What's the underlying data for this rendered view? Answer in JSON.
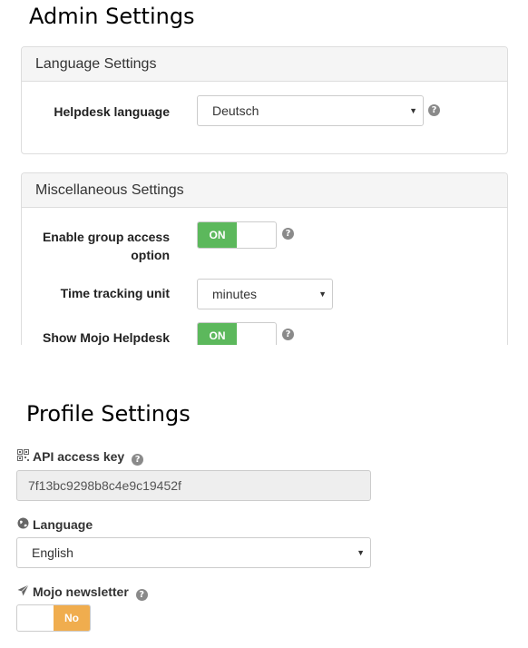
{
  "admin": {
    "title": "Admin Settings",
    "language_panel": {
      "heading": "Language Settings",
      "helpdesk_language_label": "Helpdesk language",
      "helpdesk_language_value": "Deutsch"
    },
    "misc_panel": {
      "heading": "Miscellaneous Settings",
      "group_access_label_line1": "Enable group access",
      "group_access_label_line2": "option",
      "group_access_toggle": "ON",
      "time_tracking_label": "Time tracking unit",
      "time_tracking_value": "minutes",
      "show_mojo_label": "Show Mojo Helpdesk",
      "show_mojo_toggle": "ON"
    }
  },
  "profile": {
    "title": "Profile Settings",
    "api_key_label": "API access key",
    "api_key_value": "7f13bc9298b8c4e9c19452f",
    "language_label": "Language",
    "language_value": "English",
    "newsletter_label": "Mojo newsletter",
    "newsletter_toggle": "No"
  },
  "icons": {
    "help": "question-circle-icon",
    "qr": "qrcode-icon",
    "globe": "globe-icon",
    "plane": "paper-plane-icon",
    "caret": "caret-down-icon"
  },
  "colors": {
    "on_green": "#5cb85c",
    "no_orange": "#f0ad4e",
    "panel_heading_bg": "#f5f5f5"
  }
}
